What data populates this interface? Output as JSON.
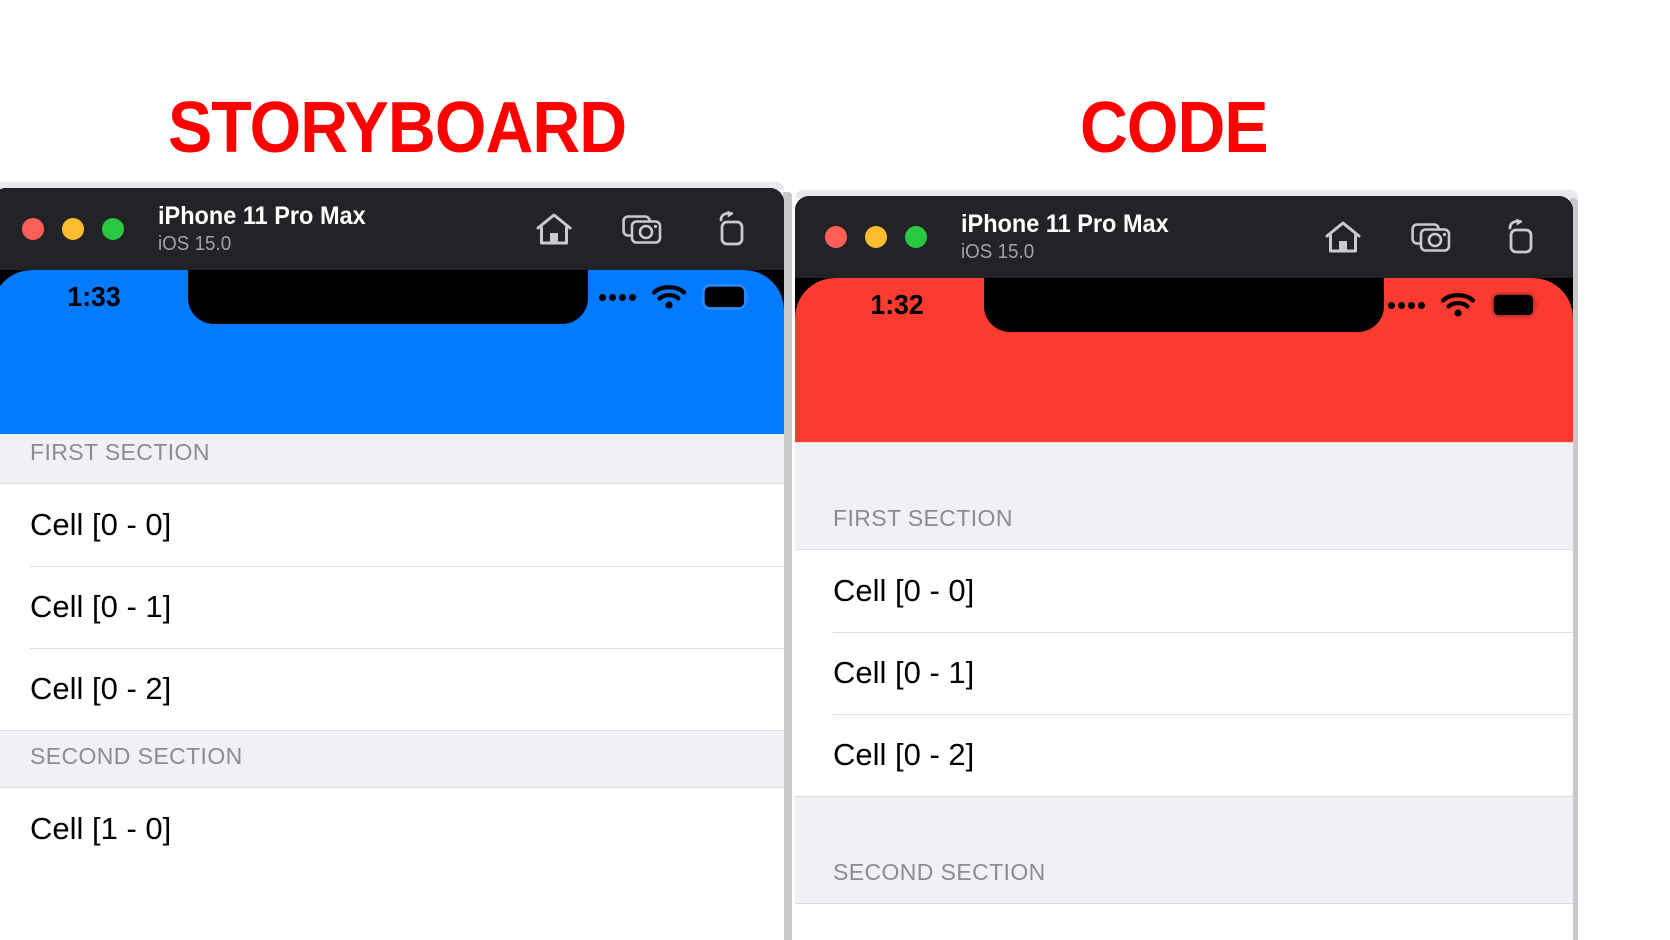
{
  "captions": {
    "left": "STORYBOARD",
    "right": "CODE",
    "color": "#fe0000"
  },
  "simulators": [
    {
      "id": "left",
      "window": {
        "title": "iPhone 11 Pro Max",
        "subtitle": "iOS 15.0",
        "traffic_lights": [
          "close",
          "minimize",
          "maximize"
        ],
        "actions": [
          "home-icon",
          "screenshot-icon",
          "rotate-icon"
        ]
      },
      "status_bar": {
        "time": "1:33",
        "signal": "signal-dots-icon",
        "wifi": "wifi-icon",
        "battery": "battery-icon"
      },
      "navbar_color": "#047aff",
      "table": {
        "rows": [
          {
            "type": "header",
            "text": "FIRST SECTION"
          },
          {
            "type": "cell",
            "text": "Cell [0 - 0]"
          },
          {
            "type": "cell",
            "text": "Cell [0 - 1]"
          },
          {
            "type": "cell",
            "text": "Cell [0 - 2]"
          },
          {
            "type": "header",
            "text": "SECOND SECTION"
          },
          {
            "type": "cell",
            "text": "Cell [1 - 0]"
          }
        ]
      }
    },
    {
      "id": "right",
      "window": {
        "title": "iPhone 11 Pro Max",
        "subtitle": "iOS 15.0",
        "traffic_lights": [
          "close",
          "minimize",
          "maximize"
        ],
        "actions": [
          "home-icon",
          "screenshot-icon",
          "rotate-icon"
        ]
      },
      "status_bar": {
        "time": "1:32",
        "signal": "signal-dots-icon",
        "wifi": "wifi-icon",
        "battery": "battery-icon"
      },
      "navbar_color": "#fb3b30",
      "table": {
        "rows": [
          {
            "type": "header",
            "text": "FIRST SECTION"
          },
          {
            "type": "cell",
            "text": "Cell [0 - 0]"
          },
          {
            "type": "cell",
            "text": "Cell [0 - 1]"
          },
          {
            "type": "cell",
            "text": "Cell [0 - 2]"
          },
          {
            "type": "header",
            "text": "SECOND SECTION"
          }
        ]
      }
    }
  ]
}
